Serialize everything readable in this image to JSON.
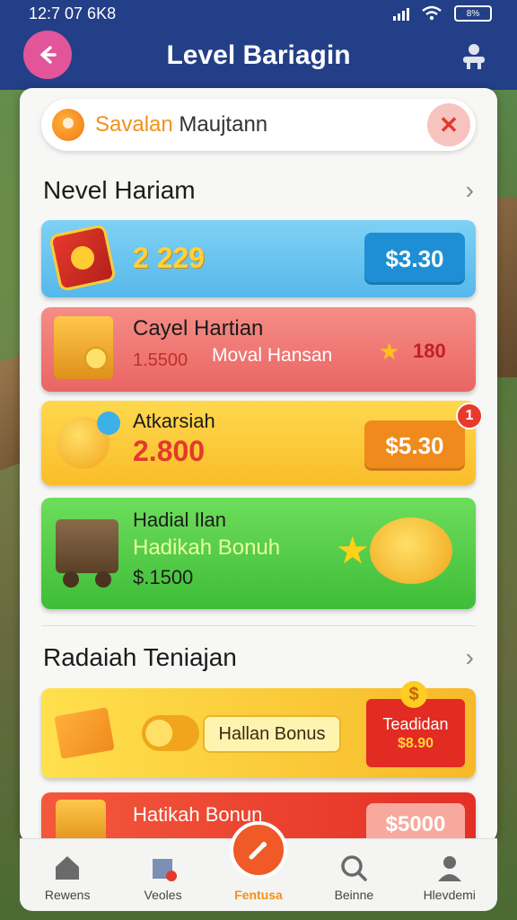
{
  "status": {
    "time": "12:7 07 6K8",
    "battery": "8%"
  },
  "header": {
    "title": "Level Bariagin"
  },
  "search": {
    "highlight": "Savalan",
    "text": " Maujtann"
  },
  "section1": {
    "title": "Nevel Hariam"
  },
  "rows": [
    {
      "value": "2 229",
      "price": "$3.30"
    },
    {
      "title": "Cayel Hartian",
      "amount": "1.5500",
      "subtitle": "Moval Hansan",
      "stars": "180"
    },
    {
      "title": "Atkarsiah",
      "amount": "2.800",
      "price": "$5.30",
      "badge": "1"
    },
    {
      "title": "Hadial Ilan",
      "subtitle": "Hadikah Bonuh",
      "amount": "$.1500"
    }
  ],
  "section2": {
    "title": "Radaiah Teniajan"
  },
  "rows2": [
    {
      "label": "Hallan Bonus",
      "tag_title": "Teadidan",
      "tag_price": "$8.90"
    },
    {
      "title": "Hatikah Bonun",
      "price": "$5000"
    }
  ],
  "nav": [
    {
      "label": "Rewens"
    },
    {
      "label": "Veoles"
    },
    {
      "label": "Fentusa"
    },
    {
      "label": "Beinne"
    },
    {
      "label": "Hlevdemi"
    }
  ],
  "colors": {
    "header": "#233f87",
    "accent": "#f0921c",
    "back": "#e2559a"
  }
}
